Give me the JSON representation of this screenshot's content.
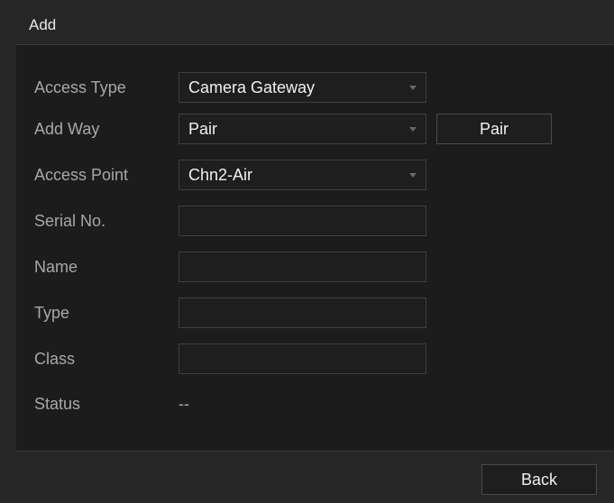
{
  "dialog": {
    "title": "Add"
  },
  "form": {
    "access_type": {
      "label": "Access Type",
      "value": "Camera Gateway"
    },
    "add_way": {
      "label": "Add Way",
      "value": "Pair",
      "pair_button": "Pair"
    },
    "access_point": {
      "label": "Access Point",
      "value": "Chn2-Air"
    },
    "serial_no": {
      "label": "Serial No.",
      "value": ""
    },
    "name": {
      "label": "Name",
      "value": ""
    },
    "type": {
      "label": "Type",
      "value": ""
    },
    "class": {
      "label": "Class",
      "value": ""
    },
    "status": {
      "label": "Status",
      "value": "--"
    }
  },
  "footer": {
    "back_label": "Back"
  },
  "icons": {
    "dropdown": "chevron-down-icon"
  },
  "colors": {
    "background": "#1c1c1c",
    "panel": "#262626",
    "label_text": "#a8a8a8",
    "value_text": "#f0f0f0",
    "field_border": "#3e3e3e"
  }
}
